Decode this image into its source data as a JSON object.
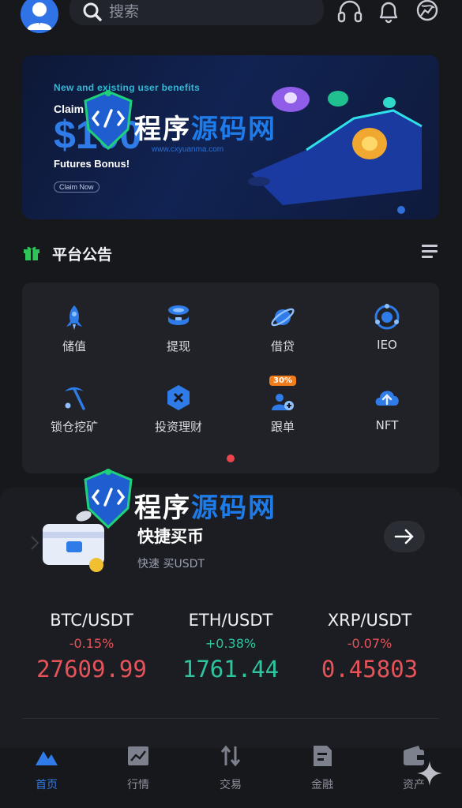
{
  "header": {
    "search_placeholder": "搜索"
  },
  "banner": {
    "line1": "New and existing user benefits",
    "line2": "Claim",
    "amount": "$100",
    "line3": "Futures Bonus!",
    "button": "Claim Now"
  },
  "watermark": {
    "text_a": "程序",
    "text_b": "源码网",
    "url": "www.cxyuanma.com"
  },
  "announcement": {
    "title": "平台公告"
  },
  "features": [
    {
      "label": "储值",
      "icon": "rocket-icon"
    },
    {
      "label": "提现",
      "icon": "coins-icon"
    },
    {
      "label": "借贷",
      "icon": "planet-icon"
    },
    {
      "label": "IEO",
      "icon": "target-icon"
    },
    {
      "label": "锁仓挖矿",
      "icon": "pickaxe-icon"
    },
    {
      "label": "投资理财",
      "icon": "hexagon-icon"
    },
    {
      "label": "跟单",
      "icon": "follow-icon",
      "badge": "30%"
    },
    {
      "label": "NFT",
      "icon": "cloud-upload-icon"
    }
  ],
  "quick_buy": {
    "title": "快捷买币",
    "subtitle": "快速 买USDT"
  },
  "tickers": [
    {
      "pair": "BTC/USDT",
      "change": "-0.15%",
      "price": "27609.99",
      "direction": "down"
    },
    {
      "pair": "ETH/USDT",
      "change": "+0.38%",
      "price": "1761.44",
      "direction": "up"
    },
    {
      "pair": "XRP/USDT",
      "change": "-0.07%",
      "price": "0.45803",
      "direction": "down"
    }
  ],
  "nav": [
    {
      "label": "首页",
      "icon": "home-icon",
      "active": true
    },
    {
      "label": "行情",
      "icon": "chart-icon",
      "active": false
    },
    {
      "label": "交易",
      "icon": "swap-icon",
      "active": false
    },
    {
      "label": "金融",
      "icon": "document-icon",
      "active": false
    },
    {
      "label": "资产",
      "icon": "wallet-icon",
      "active": false
    }
  ],
  "colors": {
    "background": "#17181c",
    "accent": "#2f7be8",
    "up": "#2ec4a0",
    "down": "#e8535a"
  }
}
